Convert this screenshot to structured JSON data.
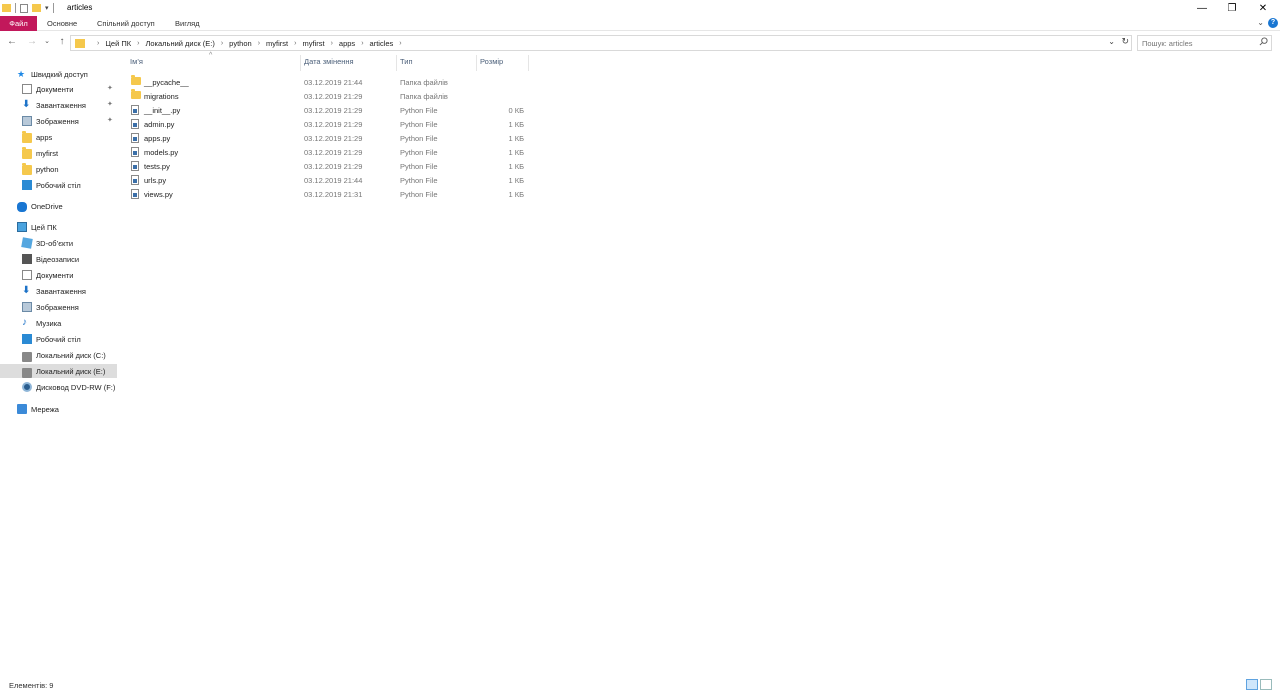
{
  "window": {
    "title": "articles",
    "controls": {
      "minimize": "—",
      "maximize": "❐",
      "close": "✕"
    }
  },
  "ribbon": {
    "tabs": [
      {
        "label": "Файл"
      },
      {
        "label": "Основне"
      },
      {
        "label": "Спільний доступ"
      },
      {
        "label": "Вигляд"
      }
    ],
    "help": "?"
  },
  "address": {
    "crumbs": [
      "Цей ПК",
      "Локальний диск (E:)",
      "python",
      "myfirst",
      "myfirst",
      "apps",
      "articles"
    ]
  },
  "search": {
    "placeholder": "Пошук: articles"
  },
  "nav": {
    "quick_access": "Швидкий доступ",
    "quick_items": [
      {
        "label": "Документи",
        "icon": "documents-icon",
        "pinned": true
      },
      {
        "label": "Завантаження",
        "icon": "downloads-icon",
        "pinned": true
      },
      {
        "label": "Зображення",
        "icon": "pictures-icon",
        "pinned": true
      },
      {
        "label": "apps",
        "icon": "folder-icon"
      },
      {
        "label": "myfirst",
        "icon": "folder-icon"
      },
      {
        "label": "python",
        "icon": "folder-icon"
      },
      {
        "label": "Робочий стіл",
        "icon": "desktop-icon"
      }
    ],
    "onedrive": "OneDrive",
    "this_pc": "Цей ПК",
    "pc_items": [
      {
        "label": "3D-об’єкти",
        "icon": "3d-objects-icon"
      },
      {
        "label": "Відеозаписи",
        "icon": "videos-icon"
      },
      {
        "label": "Документи",
        "icon": "documents-icon"
      },
      {
        "label": "Завантаження",
        "icon": "downloads-icon"
      },
      {
        "label": "Зображення",
        "icon": "pictures-icon"
      },
      {
        "label": "Музика",
        "icon": "music-icon"
      },
      {
        "label": "Робочий стіл",
        "icon": "desktop-icon"
      },
      {
        "label": "Локальний диск (C:)",
        "icon": "drive-icon"
      },
      {
        "label": "Локальний диск (E:)",
        "icon": "drive-icon",
        "selected": true
      },
      {
        "label": "Дисковод DVD-RW (F:)",
        "icon": "dvd-icon"
      }
    ],
    "network": "Мережа"
  },
  "columns": {
    "name": "Ім’я",
    "date": "Дата змінення",
    "type": "Тип",
    "size": "Розмір"
  },
  "files": [
    {
      "name": "__pycache__",
      "date": "03.12.2019 21:44",
      "type": "Папка файлів",
      "size": "",
      "icon": "folder-icon"
    },
    {
      "name": "migrations",
      "date": "03.12.2019 21:29",
      "type": "Папка файлів",
      "size": "",
      "icon": "folder-icon"
    },
    {
      "name": "__init__.py",
      "date": "03.12.2019 21:29",
      "type": "Python File",
      "size": "0 КБ",
      "icon": "python-file-icon"
    },
    {
      "name": "admin.py",
      "date": "03.12.2019 21:29",
      "type": "Python File",
      "size": "1 КБ",
      "icon": "python-file-icon"
    },
    {
      "name": "apps.py",
      "date": "03.12.2019 21:29",
      "type": "Python File",
      "size": "1 КБ",
      "icon": "python-file-icon"
    },
    {
      "name": "models.py",
      "date": "03.12.2019 21:29",
      "type": "Python File",
      "size": "1 КБ",
      "icon": "python-file-icon"
    },
    {
      "name": "tests.py",
      "date": "03.12.2019 21:29",
      "type": "Python File",
      "size": "1 КБ",
      "icon": "python-file-icon"
    },
    {
      "name": "urls.py",
      "date": "03.12.2019 21:44",
      "type": "Python File",
      "size": "1 КБ",
      "icon": "python-file-icon"
    },
    {
      "name": "views.py",
      "date": "03.12.2019 21:31",
      "type": "Python File",
      "size": "1 КБ",
      "icon": "python-file-icon"
    }
  ],
  "status": {
    "items": "Елементів: 9"
  },
  "colors": {
    "file_tab": "#c2185b",
    "accent": "#1976d2",
    "folder": "#f5c84c"
  }
}
